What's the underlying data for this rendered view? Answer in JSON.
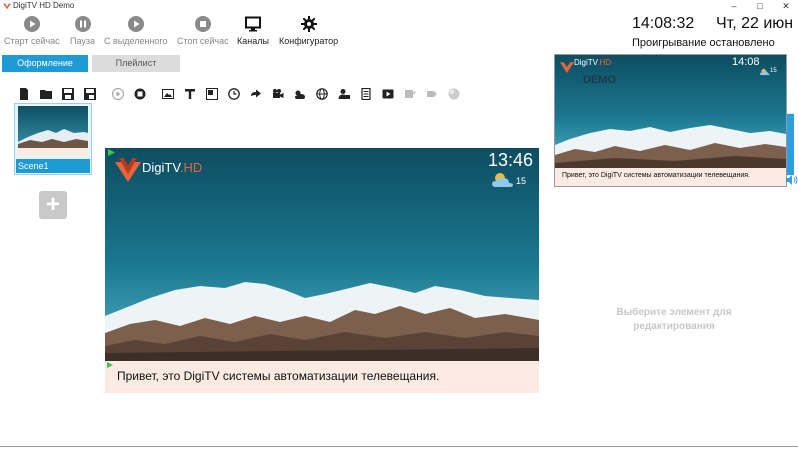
{
  "window": {
    "title": "DigiTV HD Demo",
    "controls": [
      "–",
      "□",
      "✕"
    ]
  },
  "toolbar": {
    "start_now": "Старт сейчас",
    "pause": "Пауза",
    "from_selected": "С выделенного",
    "stop_now": "Стоп сейчас",
    "channels": "Каналы",
    "configurator": "Конфигуратор"
  },
  "header": {
    "clock": "14:08:32",
    "date": "Чт, 22 июн",
    "status": "Проигрывание остановлено"
  },
  "tabs": {
    "design": "Оформление",
    "playlist": "Плейлист"
  },
  "scenes": [
    {
      "label": "Scene1"
    }
  ],
  "canvas": {
    "clock": "13:46",
    "temperature": "15",
    "brand_main": "DigiTV",
    "brand_hd": ".HD",
    "ticker": "Привет, это DigiTV системы автоматизации телевещания."
  },
  "preview": {
    "clock": "14:08",
    "temperature": "15",
    "brand_main": "DigiTV",
    "brand_hd": ".HD",
    "watermark": "DEMO",
    "ticker": "Привет, это DigiTV системы автоматизации телевещания."
  },
  "editor_hint": "Выберите элемент для редактирования",
  "volume_level": 0.98,
  "colors": {
    "accent": "#1e9bd7",
    "ticker_bg": "#fbebe2",
    "brand_hd": "#e8643b"
  }
}
